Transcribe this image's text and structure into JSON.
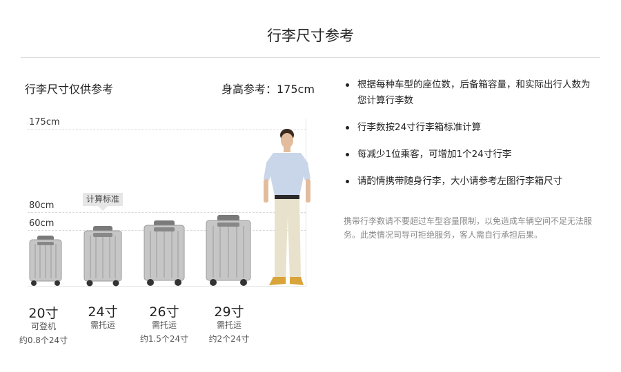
{
  "header": {
    "title": "行李尺寸参考"
  },
  "left": {
    "caption": "行李尺寸仅供参考",
    "height_ref": "身高参考：175cm",
    "scale": [
      "175cm",
      "80cm",
      "60cm"
    ],
    "calc_tag": "计算标准"
  },
  "suitcases": [
    {
      "size": "20寸",
      "desc1": "可登机",
      "desc2": "约0.8个24寸"
    },
    {
      "size": "24寸",
      "desc1": "需托运",
      "desc2": ""
    },
    {
      "size": "26寸",
      "desc1": "需托运",
      "desc2": "约1.5个24寸"
    },
    {
      "size": "29寸",
      "desc1": "需托运",
      "desc2": "约2个24寸"
    }
  ],
  "notes": [
    "根据每种车型的座位数，后备箱容量，和实际出行人数为您计算行李数",
    "行李数按24寸行李箱标准计算",
    "每减少1位乘客，可增加1个24寸行李",
    "请酌情携带随身行李，大小请参考左图行李箱尺寸"
  ],
  "disclaimer": "携带行李数请不要超过车型容量限制，以免造成车辆空间不足无法服务。此类情况司导可拒绝服务，客人需自行承担后果。",
  "colors": {
    "suitcase_body": "#c4c4c4",
    "suitcase_dark": "#555555",
    "divider": "#dddddd",
    "note_gray": "#888888"
  }
}
